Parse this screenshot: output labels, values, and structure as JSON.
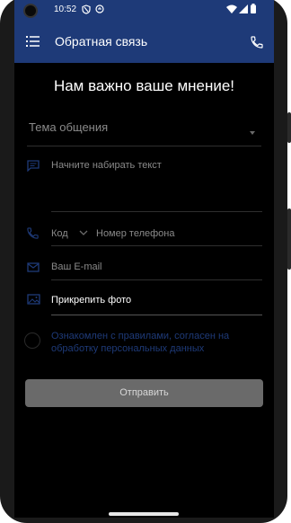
{
  "status_bar": {
    "time": "10:52"
  },
  "app_bar": {
    "title": "Обратная связь"
  },
  "heading": "Нам важно ваше мнение!",
  "form": {
    "topic_placeholder": "Тема общения",
    "message_placeholder": "Начните набирать текст",
    "country_code_placeholder": "Код",
    "phone_placeholder": "Номер телефона",
    "email_placeholder": "Ваш E-mail",
    "attach_label": "Прикрепить фото",
    "agreement_text": "Ознакомлен с правилами, согласен на обработку персональных данных",
    "submit_label": "Отправить"
  },
  "colors": {
    "primary": "#1e3a78",
    "background": "#000000",
    "button_disabled": "#6a6a6a"
  }
}
